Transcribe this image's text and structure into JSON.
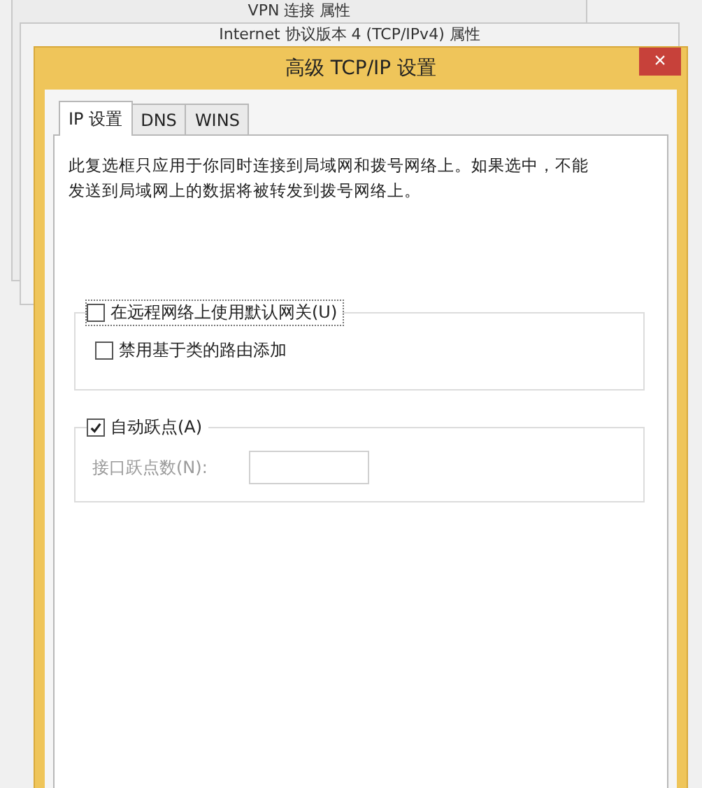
{
  "background_windows": [
    {
      "title": "VPN 连接 属性"
    },
    {
      "title": "Internet 协议版本 4 (TCP/IPv4) 属性"
    }
  ],
  "window": {
    "title": "高级 TCP/IP 设置",
    "close": "×"
  },
  "tabs": [
    {
      "label": "IP 设置",
      "selected": true
    },
    {
      "label": "DNS",
      "selected": false
    },
    {
      "label": "WINS",
      "selected": false
    }
  ],
  "description": "此复选框只应用于你同时连接到局域网和拨号网络上。如果选中，不能发送到局域网上的数据将被转发到拨号网络上。",
  "gateway_group": {
    "checkbox": {
      "label": "在远程网络上使用默认网关(U)",
      "checked": false
    },
    "option": {
      "label": "禁用基于类的路由添加",
      "checked": false
    }
  },
  "hop_group": {
    "checkbox": {
      "label": "自动跃点(A)",
      "checked": true
    },
    "metric": {
      "label": "接口跃点数(N):",
      "disabled": true
    }
  }
}
